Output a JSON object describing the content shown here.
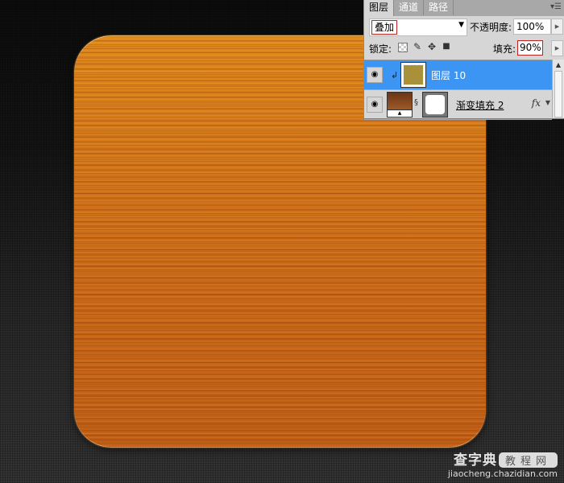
{
  "canvas": {
    "wood_colors": {
      "top": "#e08a1c",
      "bottom": "#c15f16"
    },
    "background_color": "#1a1a1a"
  },
  "layers_panel": {
    "tabs": [
      {
        "label": "图层",
        "active": true
      },
      {
        "label": "通道",
        "active": false
      },
      {
        "label": "路径",
        "active": false
      }
    ],
    "menu_icon": "panel-menu-icon",
    "blend_mode": "叠加",
    "opacity_label": "不透明度:",
    "opacity_value": "100%",
    "lock_label": "锁定:",
    "fill_label": "填充:",
    "fill_value": "90%",
    "layers": [
      {
        "name": "图层 10",
        "selected": true,
        "clipped": true,
        "visible": true
      },
      {
        "name": "渐变填充 2",
        "selected": false,
        "has_mask": true,
        "has_fx": true,
        "fx_label": "fx",
        "visible": true
      }
    ]
  },
  "watermark": {
    "brand": "查字典",
    "badge": "教程网",
    "url": "jiaocheng.chazidian.com"
  }
}
